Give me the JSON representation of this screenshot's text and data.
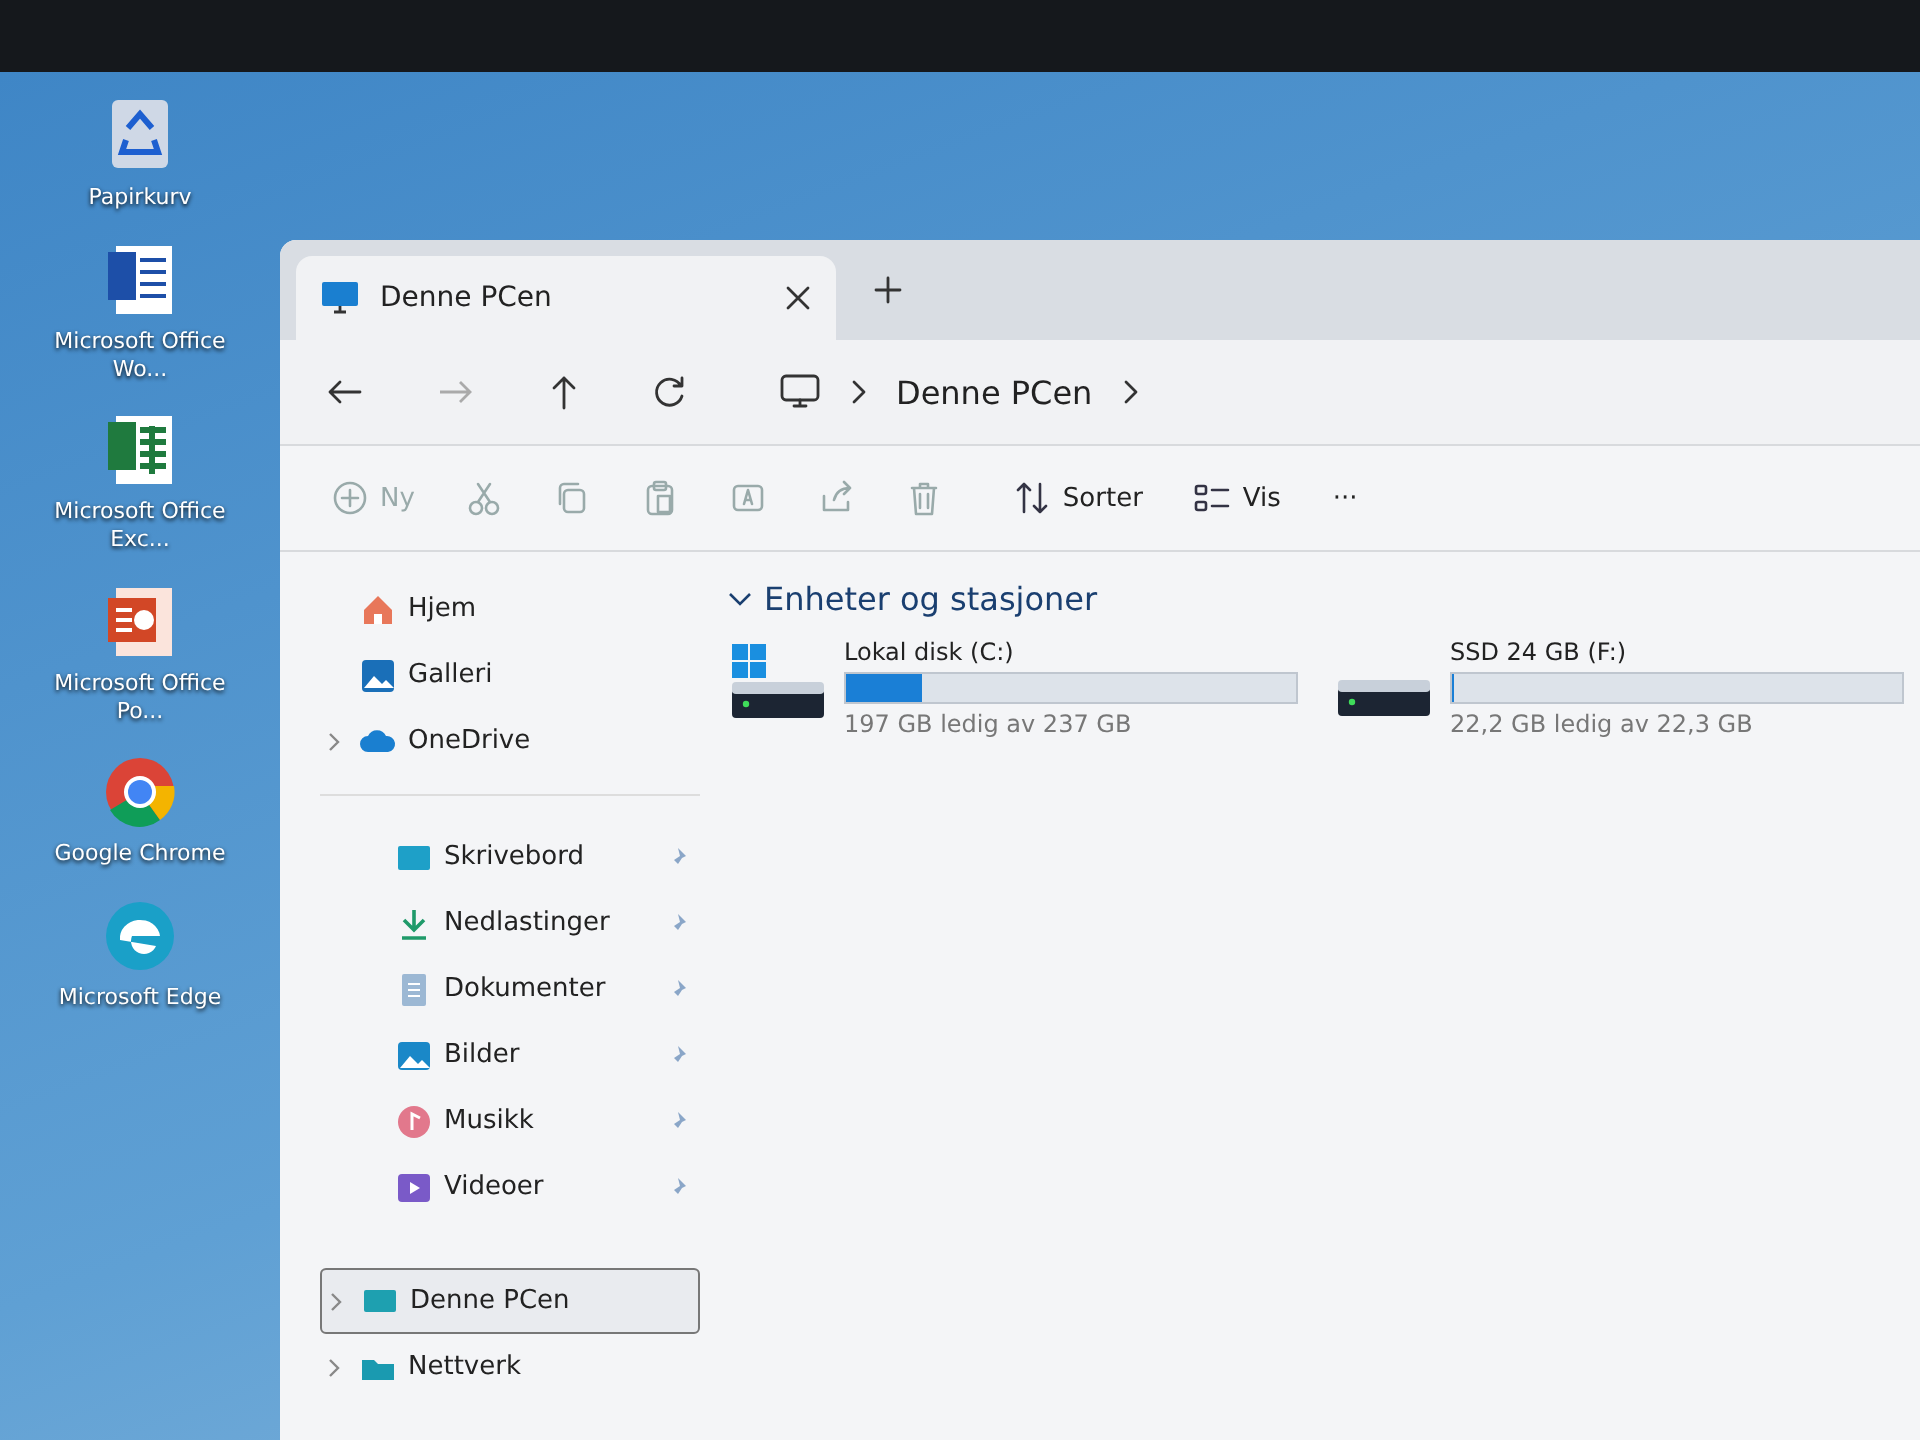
{
  "desktop_icons": [
    {
      "kind": "recycle",
      "label": "Papirkurv"
    },
    {
      "kind": "word",
      "label": "Microsoft Office Wo..."
    },
    {
      "kind": "excel",
      "label": "Microsoft Office Exc..."
    },
    {
      "kind": "powerpoint",
      "label": "Microsoft Office Po..."
    },
    {
      "kind": "chrome",
      "label": "Google Chrome"
    },
    {
      "kind": "edge",
      "label": "Microsoft Edge"
    }
  ],
  "window": {
    "tabs": [
      {
        "title": "Denne PCen",
        "selected": true
      }
    ],
    "address": {
      "crumbs": [
        "Denne PCen"
      ]
    },
    "toolbar": [
      {
        "kind": "new",
        "label": "Ny",
        "disabled": true
      },
      {
        "kind": "cut",
        "disabled": true
      },
      {
        "kind": "copy",
        "disabled": true
      },
      {
        "kind": "paste",
        "disabled": true
      },
      {
        "kind": "rename",
        "disabled": true
      },
      {
        "kind": "share",
        "disabled": true
      },
      {
        "kind": "delete",
        "disabled": true
      },
      {
        "kind": "sort",
        "label": "Sorter",
        "disabled": false
      },
      {
        "kind": "view",
        "label": "Vis",
        "disabled": false
      },
      {
        "kind": "more",
        "label": "···",
        "disabled": false
      }
    ],
    "sidebar": {
      "top": [
        {
          "kind": "home",
          "label": "Hjem",
          "expandable": false
        },
        {
          "kind": "gallery",
          "label": "Galleri",
          "expandable": false
        },
        {
          "kind": "cloud",
          "label": "OneDrive",
          "expandable": true
        }
      ],
      "pinned": [
        {
          "kind": "desktop",
          "label": "Skrivebord"
        },
        {
          "kind": "download",
          "label": "Nedlastinger"
        },
        {
          "kind": "document",
          "label": "Dokumenter"
        },
        {
          "kind": "picture",
          "label": "Bilder"
        },
        {
          "kind": "music",
          "label": "Musikk"
        },
        {
          "kind": "video",
          "label": "Videoer"
        }
      ],
      "bottom": [
        {
          "kind": "pc",
          "label": "Denne PCen",
          "selected": true
        },
        {
          "kind": "network",
          "label": "Nettverk",
          "selected": false
        }
      ]
    },
    "section": {
      "title": "Enheter og stasjoner",
      "expanded": true,
      "drives": [
        {
          "kind": "system",
          "name": "Lokal disk (C:)",
          "level": 0.17,
          "free": "197 GB ledig av 237 GB"
        },
        {
          "kind": "plain",
          "name": "SSD 24 GB (F:)",
          "level": 0.005,
          "free": "22,2 GB ledig av 22,3 GB"
        }
      ]
    }
  }
}
